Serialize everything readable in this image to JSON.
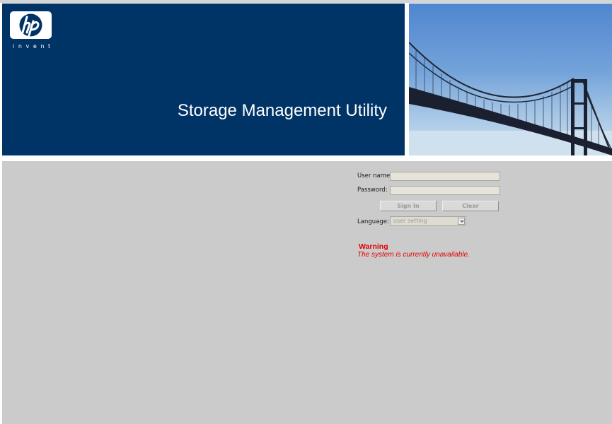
{
  "banner": {
    "logo_text": "hp",
    "logo_tagline": "invent",
    "title": "Storage Management Utility",
    "background_color": "#003366"
  },
  "login": {
    "username_label": "User name:",
    "username_value": "",
    "password_label": "Password:",
    "password_value": "",
    "sign_in_label": "Sign In",
    "clear_label": "Clear",
    "language_label": "Language:",
    "language_selected": "user setting"
  },
  "warning": {
    "title": "Warning",
    "message": "The system is currently unavailable.",
    "color": "#e00000"
  },
  "icons": {
    "logo": "hp-logo-icon",
    "dropdown": "chevron-down-icon"
  }
}
